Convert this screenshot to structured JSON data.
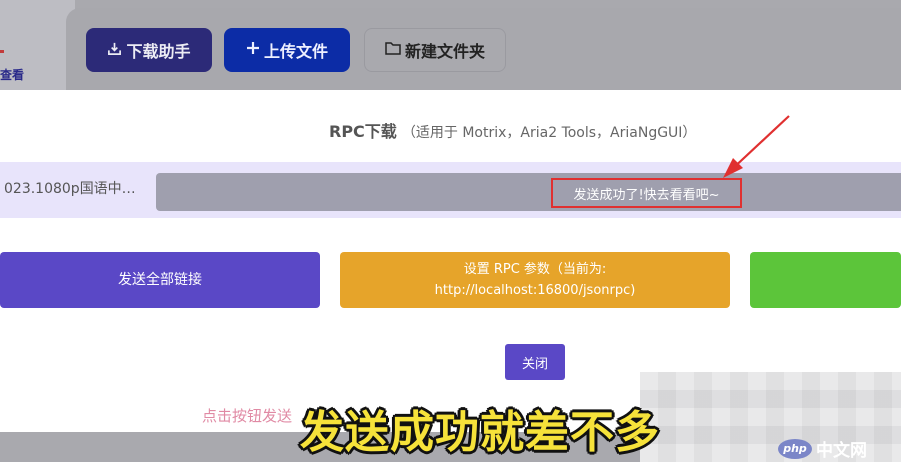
{
  "background": {
    "left_link": "查看",
    "toolbar": {
      "download_helper": "下载助手",
      "upload_file": "上传文件",
      "new_folder": "新建文件夹"
    }
  },
  "modal": {
    "title": "RPC下载",
    "title_note": "（适用于 Motrix，Aria2 Tools，AriaNgGUI）",
    "file_name": "023.1080p国语中…",
    "status_message": "发送成功了!快去看看吧~",
    "send_all_label": "发送全部链接",
    "rpc_settings_line1": "设置 RPC 参数（当前为:",
    "rpc_settings_line2": "http://localhost:16800/jsonrpc)",
    "close_label": "关闭",
    "hint_text": "点击按钮发送"
  },
  "overlay": {
    "subtitle": "发送成功就差不多",
    "watermark": "中文网",
    "watermark_logo": "php"
  },
  "colors": {
    "primary_purple": "#5a48c6",
    "orange": "#e6a42a",
    "green": "#5cc53a",
    "highlight_red": "#e03030",
    "subtitle_yellow": "#f6e23a"
  }
}
